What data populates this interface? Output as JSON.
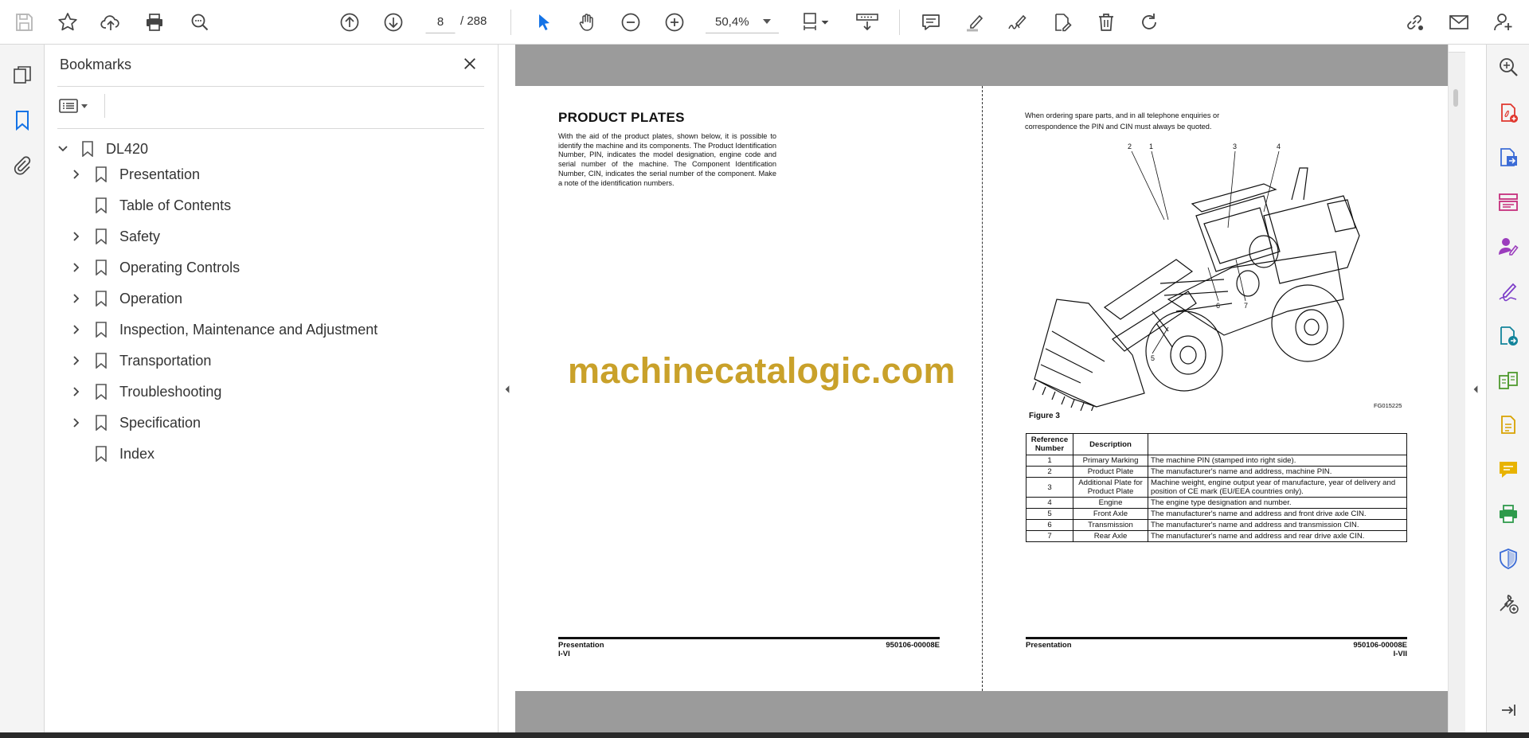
{
  "toolbar": {
    "page_current": "8",
    "page_total": "/ 288",
    "zoom": "50,4%"
  },
  "bookmarks": {
    "title": "Bookmarks",
    "root": "DL420",
    "items": [
      {
        "label": "Presentation",
        "expandable": true
      },
      {
        "label": "Table of Contents",
        "expandable": false
      },
      {
        "label": "Safety",
        "expandable": true
      },
      {
        "label": "Operating Controls",
        "expandable": true
      },
      {
        "label": "Operation",
        "expandable": true
      },
      {
        "label": "Inspection, Maintenance and Adjustment",
        "expandable": true
      },
      {
        "label": "Transportation",
        "expandable": true
      },
      {
        "label": "Troubleshooting",
        "expandable": true
      },
      {
        "label": "Specification",
        "expandable": true
      },
      {
        "label": "Index",
        "expandable": false
      }
    ]
  },
  "document": {
    "left_page": {
      "heading": "PRODUCT PLATES",
      "body": "With the aid of the product plates, shown below, it is possible to identify the machine and its components. The Product Identification Number, PIN, indicates the model designation, engine code and serial number of the machine. The Component Identification Number, CIN, indicates the serial number of the component. Make a note of the identification numbers.",
      "footer_section": "Presentation",
      "footer_page": "I-VI",
      "footer_code": "950106-00008E"
    },
    "right_page": {
      "intro": "When ordering spare parts, and in all telephone enquiries or correspondence the PIN and CIN must always be quoted.",
      "figure_label": "Figure 3",
      "figure_code": "FG015225",
      "callouts": [
        "1",
        "2",
        "3",
        "4",
        "5",
        "6",
        "7"
      ],
      "table": {
        "headers": [
          "Reference Number",
          "Description",
          ""
        ],
        "rows": [
          [
            "1",
            "Primary Marking",
            "The machine PIN (stamped into right side)."
          ],
          [
            "2",
            "Product Plate",
            "The manufacturer's name and address, machine PIN."
          ],
          [
            "3",
            "Additional Plate for Product Plate",
            "Machine weight, engine output year of manufacture, year of delivery and position of CE mark (EU/EEA countries only)."
          ],
          [
            "4",
            "Engine",
            "The engine type designation and number."
          ],
          [
            "5",
            "Front Axle",
            "The manufacturer's name and address and front drive axle CIN."
          ],
          [
            "6",
            "Transmission",
            "The manufacturer's name and address and transmission CIN."
          ],
          [
            "7",
            "Rear Axle",
            "The manufacturer's name and address and rear drive axle CIN."
          ]
        ]
      },
      "footer_section": "Presentation",
      "footer_page": "I-VII",
      "footer_code": "950106-00008E"
    },
    "watermark": "machinecatalogic.com"
  },
  "colors": {
    "accent_blue": "#1473e6",
    "watermark": "#c9a12a",
    "gray_band": "#9b9b9b"
  }
}
